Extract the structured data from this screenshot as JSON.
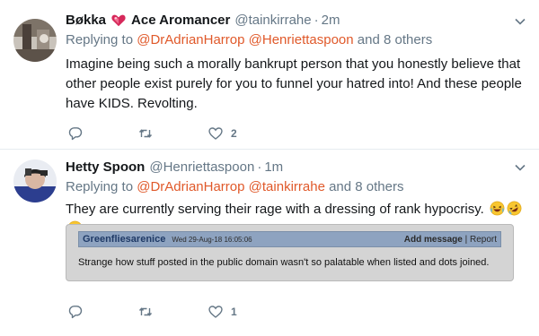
{
  "tweets": [
    {
      "display_name": "Bøkka",
      "badge": "Ace Aromancer",
      "handle": "@tainkirrahe",
      "dot": "·",
      "time": "2m",
      "reply_prefix": "Replying to",
      "mention_1": "@DrAdrianHarrop",
      "mention_2": "@Henriettaspoon",
      "reply_suffix": "and 8 others",
      "text": "Imagine being such a morally bankrupt person that you honestly believe that other people exist purely for you to funnel your hatred into! And these people have KIDS. Revolting.",
      "reply_count": "",
      "retweet_count": "",
      "like_count": "2"
    },
    {
      "display_name": "Hetty Spoon",
      "handle": "@Henriettaspoon",
      "dot": "·",
      "time": "1m",
      "reply_prefix": "Replying to",
      "mention_1": "@DrAdrianHarrop",
      "mention_2": "@tainkirrahe",
      "reply_suffix": "and 8 others",
      "text": "They are currently serving their rage with a dressing of rank hypocrisy.",
      "embed": {
        "user": "Greenfliesarenice",
        "date": "Wed 29-Aug-18 16:05:06",
        "add_message": "Add message",
        "separator": "|",
        "report": "Report",
        "text": "Strange how stuff posted in the public domain wasn't so palatable when listed and dots joined."
      },
      "reply_count": "",
      "retweet_count": "",
      "like_count": "1"
    }
  ],
  "colors": {
    "accent": "#e0592a",
    "muted": "#657786",
    "embed_bar": "#8ea3c0",
    "embed_bg": "#d4d4d4"
  },
  "icons": [
    "reply-icon",
    "retweet-icon",
    "like-icon",
    "caret-down-icon",
    "heart-badge-icon",
    "laughing-emoji",
    "rofl-emoji"
  ]
}
